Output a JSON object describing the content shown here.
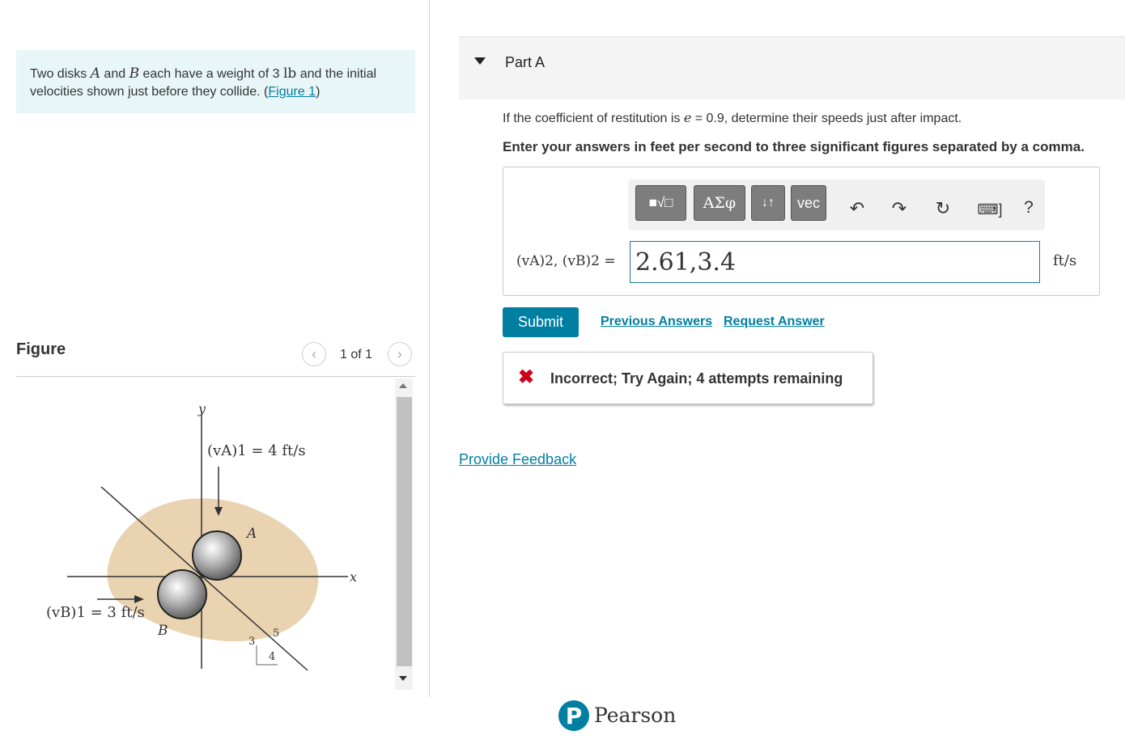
{
  "problem": {
    "text_1": "Two disks ",
    "var_a": "A",
    "text_2": " and ",
    "var_b": "B",
    "text_3": " each have a weight of 3 ",
    "unit_lb": "lb",
    "text_4": " and the initial velocities shown just before they collide. (",
    "figure_link": "Figure 1",
    "text_5": ")"
  },
  "figure_panel": {
    "title": "Figure",
    "pager_text": "1 of 1",
    "prev_icon": "chevron-left-icon",
    "next_icon": "chevron-right-icon",
    "labels": {
      "y_axis": "y",
      "x_axis": "x",
      "va": "(vA)1 = 4 ft/s",
      "vb": "(vB)1 = 3 ft/s",
      "disk_a": "A",
      "disk_b": "B",
      "tri_3": "3",
      "tri_4": "4",
      "tri_5": "5"
    }
  },
  "part_a": {
    "label": "Part A",
    "question_1": "If the coefficient of restitution is ",
    "question_var": "e",
    "question_2": " = 0.9, determine their speeds just after impact.",
    "instruction": "Enter your answers in feet per second to three significant figures separated by a comma.",
    "toolbar": {
      "templates_label": "■√□",
      "greek_label": "ΑΣφ",
      "arrows_label": "↓↑",
      "vec_label": "vec",
      "undo_icon": "undo-icon",
      "redo_icon": "redo-icon",
      "reset_icon": "reset-icon",
      "keyboard_icon": "keyboard-icon",
      "help_label": "?"
    },
    "answer_label": "(vA)2, (vB)2 =",
    "answer_value": "2.61,3.4",
    "unit": "ft/s",
    "submit_label": "Submit",
    "previous_answers": "Previous Answers",
    "request_answer": "Request Answer",
    "feedback": "Incorrect; Try Again; 4 attempts remaining"
  },
  "provide_feedback": "Provide Feedback",
  "footer": {
    "brand": "Pearson",
    "logo_letter": "P"
  },
  "colors": {
    "accent": "#007fa3",
    "error": "#d0021b",
    "problem_bg": "#e8f6f8"
  }
}
